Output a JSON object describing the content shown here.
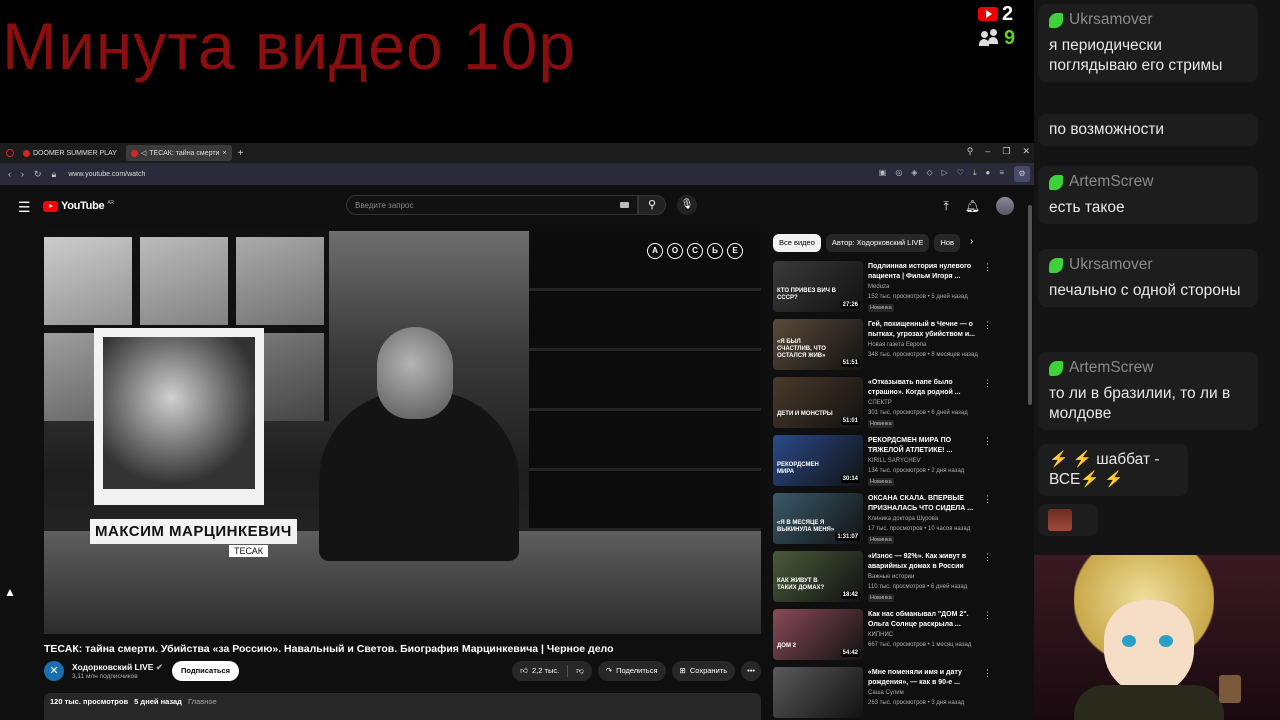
{
  "overlay": {
    "title": "Минута видео 10р",
    "youtube_count": "2",
    "viewer_count": "9"
  },
  "browser": {
    "tabs": [
      {
        "label": "DOOMER SUMMER PLAY"
      },
      {
        "label": "ТЕСАК: тайна смерти"
      }
    ],
    "url": "www.youtube.com/watch"
  },
  "youtube": {
    "logo": "YouTube",
    "logo_region": "AR",
    "search_placeholder": "Введите запрос",
    "video": {
      "name_plate": "МАКСИМ МАРЦИНКЕВИЧ",
      "name_tag": "ТЕСАК",
      "corner_letters": [
        "А",
        "О",
        "С",
        "Ь",
        "Е"
      ],
      "title": "ТЕСАК: тайна смерти. Убийства «за Россию». Навальный и Светов. Биография Марцинкевича | Черное дело",
      "channel": "Ходорковский LIVE",
      "subscribers": "3,11 млн подписчиков",
      "subscribe_label": "Подписаться",
      "likes": "2,2 тыс.",
      "share_label": "Поделиться",
      "save_label": "Сохранить",
      "views": "120 тыс. просмотров",
      "date": "5 дней назад",
      "tag": "Главное"
    },
    "chips": [
      "Все видео",
      "Автор: Ходорковский LIVE",
      "Нов"
    ],
    "related": [
      {
        "title": "Подлинная история нулевого пациента | Фильм Игоря ...",
        "channel": "Meduza",
        "meta": "152 тыс. просмотров • 5 дней назад",
        "badge": "Новинка",
        "duration": "27:26",
        "thumb_text": "КТО ПРИВЕЗ ВИЧ В СССР?",
        "thumb_color": "#3a3a3a"
      },
      {
        "title": "Гей, похищенный в Чечне — о пытках, угрозах убийством и...",
        "channel": "Новая газета Европа",
        "meta": "348 тыс. просмотров • 8 месяцев назад",
        "badge": "",
        "duration": "51:51",
        "thumb_text": "«Я БЫЛ СЧАСТЛИВ, ЧТО ОСТАЛСЯ ЖИВ»",
        "thumb_color": "#5a4a3a"
      },
      {
        "title": "«Отказывать папе было страшно». Когда родной ...",
        "channel": "СПЕКТР",
        "meta": "301 тыс. просмотров • 6 дней назад",
        "badge": "Новинка",
        "duration": "51:01",
        "thumb_text": "ДЕТИ И МОНСТРЫ",
        "thumb_color": "#4a3a2a"
      },
      {
        "title": "РЕКОРДСМЕН МИРА ПО ТЯЖЕЛОЙ АТЛЕТИКЕ! ...",
        "channel": "KIRILL SARYCHEV",
        "meta": "134 тыс. просмотров • 2 дня назад",
        "badge": "Новинка",
        "duration": "30:14",
        "thumb_text": "РЕКОРДСМЕН МИРА",
        "thumb_color": "#2a4a8a"
      },
      {
        "title": "ОКСАНА СКАЛА. ВПЕРВЫЕ ПРИЗНАЛАСЬ ЧТО СИДЕЛА ...",
        "channel": "Клиника доктора Шурова",
        "meta": "17 тыс. просмотров • 10 часов назад",
        "badge": "Новинка",
        "duration": "1:31:07",
        "thumb_text": "«Я В МЕСЯЦЕ Я ВЫКИНУЛА МЕНЯ»",
        "thumb_color": "#3a5a6a"
      },
      {
        "title": "«Износ — 92%». Как живут в аварийных домах в России",
        "channel": "Важные истории",
        "meta": "110 тыс. просмотров • 6 дней назад",
        "badge": "Новинка",
        "duration": "18:42",
        "thumb_text": "КАК ЖИВУТ В ТАКИХ ДОМАХ?",
        "thumb_color": "#4a5a3a"
      },
      {
        "title": "Как нас обманывал \"ДОМ 2\". Ольга Солнце раскрыла ...",
        "channel": "КИПНИС",
        "meta": "667 тыс. просмотров • 1 месяц назад",
        "badge": "",
        "duration": "54:42",
        "thumb_text": "ДОМ 2",
        "thumb_color": "#8a4a5a"
      },
      {
        "title": "«Мне поменяли имя и дату рождения», — как в 90-е ...",
        "channel": "Саша Сулим",
        "meta": "263 тыс. просмотров • 3 дня назад",
        "badge": "",
        "duration": "",
        "thumb_text": "",
        "thumb_color": "#5a5a5a"
      }
    ]
  },
  "chat": {
    "messages": [
      {
        "user": "Ukrsamover",
        "text": "я периодически поглядываю его стримы"
      },
      {
        "user": "",
        "text": "по возможности"
      },
      {
        "user": "ArtemScrew",
        "text": "есть такое"
      },
      {
        "user": "Ukrsamover",
        "text": "печально с одной стороны"
      },
      {
        "user": "ArtemScrew",
        "text": "то ли в бразилии, то ли в молдове"
      },
      {
        "user": "",
        "text": "⚡ ⚡ шаббат - ВСЕ⚡ ⚡"
      }
    ]
  },
  "colors": {
    "overlay_red": "#8b0e0e",
    "chat_user_green": "#3fd13a",
    "yt_red": "#ff0000"
  }
}
